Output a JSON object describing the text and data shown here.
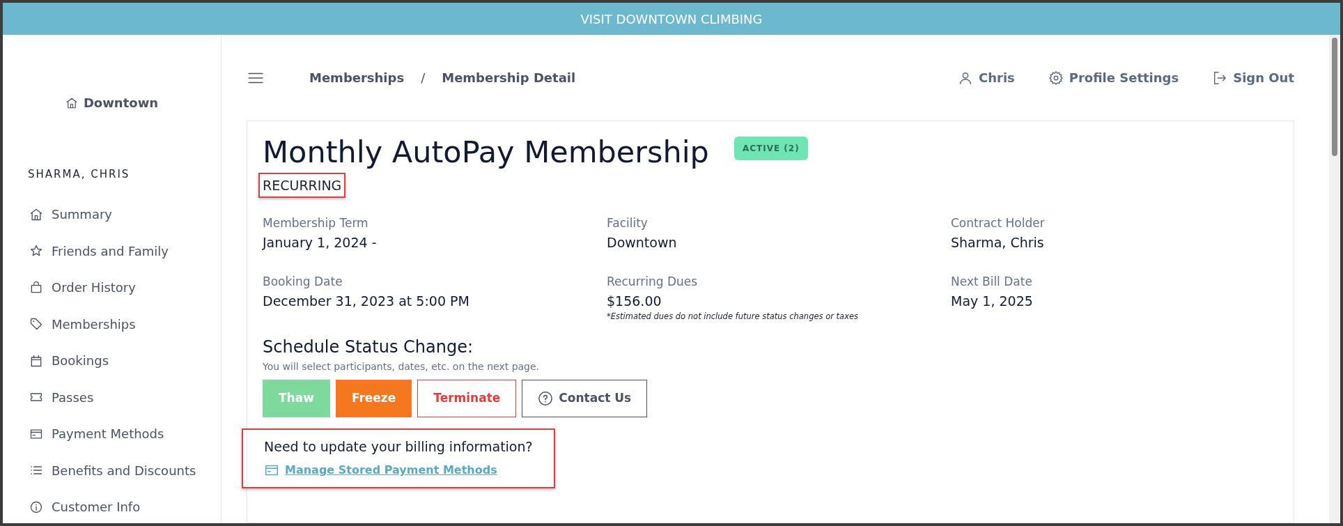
{
  "top_banner": {
    "text": "VISIT DOWNTOWN CLIMBING"
  },
  "sidebar": {
    "location": "Downtown",
    "customer": "SHARMA, CHRIS",
    "items": [
      {
        "label": "Summary",
        "selected": false
      },
      {
        "label": "Friends and Family",
        "selected": false
      },
      {
        "label": "Order History",
        "selected": false
      },
      {
        "label": "Memberships",
        "selected": false
      },
      {
        "label": "Bookings",
        "selected": false
      },
      {
        "label": "Passes",
        "selected": false
      },
      {
        "label": "Payment Methods",
        "selected": false
      },
      {
        "label": "Benefits and Discounts",
        "selected": false
      },
      {
        "label": "Customer Info",
        "selected": false
      }
    ]
  },
  "breadcrumb": [
    "Memberships",
    "/",
    "Membership Detail"
  ],
  "user_menu": [
    {
      "label": "Chris"
    },
    {
      "label": "Profile Settings"
    },
    {
      "label": "Sign Out"
    }
  ],
  "membership": {
    "title": "Monthly AutoPay Membership",
    "status_badge": "ACTIVE (2)",
    "type": "RECURRING",
    "type_highlighted": true,
    "fields": [
      {
        "label": "Membership Term",
        "value": "January 1, 2024 -"
      },
      {
        "label": "Facility",
        "value": "Downtown"
      },
      {
        "label": "Contract Holder",
        "value": "Sharma, Chris"
      },
      {
        "label": "Booking Date",
        "value": "December 31, 2023 at 5:00 PM"
      },
      {
        "label": "Recurring Dues",
        "value": "$156.00",
        "note": "*Estimated dues do not include future status changes or taxes"
      },
      {
        "label": "Next Bill Date",
        "value": "May 1, 2025"
      }
    ]
  },
  "status_change": {
    "heading": "Schedule Status Change:",
    "hint": "You will select participants, dates, etc. on the next page.",
    "buttons": [
      {
        "label": "Thaw",
        "kind": "thaw"
      },
      {
        "label": "Freeze",
        "kind": "freeze"
      },
      {
        "label": "Terminate",
        "kind": "terminate"
      },
      {
        "label": "Contact Us",
        "kind": "contact"
      }
    ]
  },
  "billing": {
    "question": "Need to update your billing information?",
    "link": "Manage Stored Payment Methods",
    "highlighted": true
  }
}
